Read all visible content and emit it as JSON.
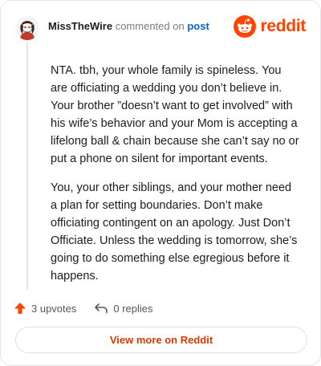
{
  "comment": {
    "author": "MissTheWire",
    "action_text": "commented on",
    "post_link_text": "post",
    "paragraphs": [
      "NTA. tbh, your whole family is spineless. You are officiating a wedding you don’t believe in. Your brother ”doesn’t want to get involved” with his wife’s behavior and your Mom is accepting a lifelong ball & chain because she can’t say no or put a phone on silent for important events.",
      "You, your other siblings, and your mother need a plan for setting boundaries. Don’t make officiating contingent on an apology. Just Don’t Officiate. Unless the wedding is tomorrow, she’s going to do something else egregious before it happens."
    ],
    "upvotes_label": "3 upvotes",
    "replies_label": "0 replies"
  },
  "brand": {
    "wordmark": "reddit",
    "icon": "reddit-snoo-icon",
    "color": "#ff4500"
  },
  "view_button_label": "View more on Reddit",
  "colors": {
    "link": "#0a65c2",
    "upvote": "#ff4500",
    "button_text": "#d93a00"
  }
}
